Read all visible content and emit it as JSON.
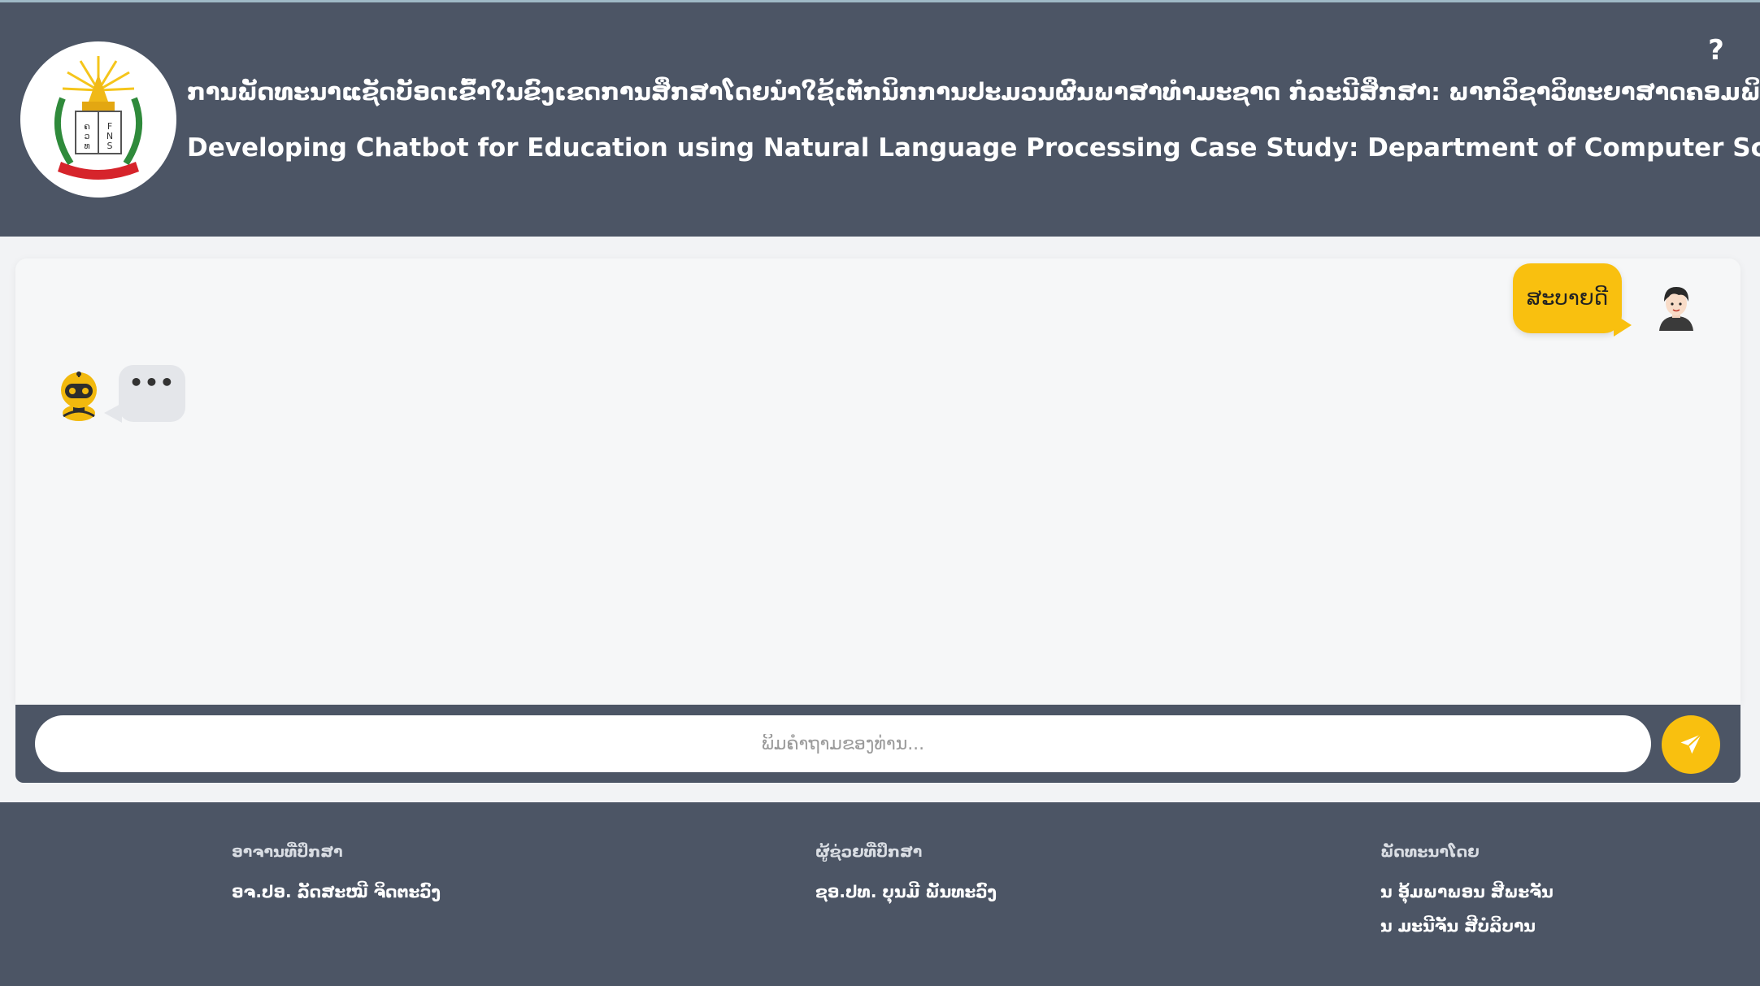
{
  "header": {
    "title_lao": "ການພັດທະນາແຊັດບັອດເຂົ້າໃນຂົງເຂດການສຶກສາໂດຍນຳໃຊ້ເຕັກນິກການປະມວນຜົນພາສາທຳມະຊາດ ກໍລະນີສຶກສາ: ພາກວິຊາວິທະຍາສາດຄອມພິວເຕີ",
    "title_en": "Developing Chatbot for Education using Natural Language Processing Case Study: Department of Computer Science",
    "help_label": "?",
    "logo_letters": [
      "ຄ",
      "ວ",
      "ທ",
      "F",
      "N",
      "S"
    ]
  },
  "chat": {
    "messages": [
      {
        "sender": "user",
        "text": "ສະບາຍດີ",
        "avatar": "user-avatar-icon"
      },
      {
        "sender": "bot",
        "text": "•••",
        "avatar": "robot-avatar-icon"
      }
    ]
  },
  "input": {
    "placeholder": "ພິມຄຳຖາມຂອງທ່ານ...",
    "value": "",
    "send_icon": "paper-plane-icon"
  },
  "footer": {
    "advisor": {
      "heading": "ອາຈານທີ່ປຶກສາ",
      "names": [
        "ອຈ.ປອ. ລັດສະໝີ ຈິດຕະວົງ"
      ]
    },
    "co_advisor": {
      "heading": "ຜູ້ຊ່ວຍທີ່ປຶກສາ",
      "names": [
        "ຊອ.ປທ. ບຸນມີ ພັນທະວົງ"
      ]
    },
    "developers": {
      "heading": "ພັດທະນາໂດຍ",
      "names": [
        "ນ ອຸ້ມພາພອນ ສີພະຈັນ",
        "ນ ມະນີຈັນ ສີບໍລິບານ"
      ]
    }
  },
  "colors": {
    "header_bg": "#4c5565",
    "accent": "#f9c00f",
    "bot_bubble": "#e4e6ea",
    "chat_bg": "#f6f7f8"
  }
}
